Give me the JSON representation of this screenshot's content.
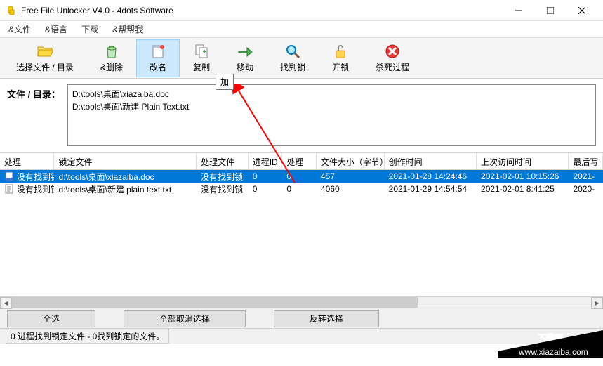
{
  "titlebar": {
    "title": "Free File Unlocker V4.0 - 4dots Software"
  },
  "menubar": {
    "file": "文件",
    "language": "语言",
    "download": "下载",
    "help": "帮帮我"
  },
  "toolbar": {
    "select": "选择文件 / 目录",
    "delete": "删除",
    "rename": "改名",
    "copy": "复制",
    "move": "移动",
    "findlock": "找到锁",
    "unlock": "开锁",
    "kill": "杀死过程"
  },
  "tooltip": "加",
  "path": {
    "label": "文件 / 目录：",
    "lines": [
      "D:\\tools\\桌面\\xiazaiba.doc",
      "D:\\tools\\桌面\\新建 Plain Text.txt"
    ]
  },
  "grid": {
    "headers": {
      "proc": "处理",
      "lockfile": "锁定文件",
      "procfile": "处理文件",
      "pid": "进程ID",
      "proc2": "处理",
      "size": "文件大小（字节）",
      "ctime": "创作时间",
      "atime": "上次访问时间",
      "mtime": "最后写"
    },
    "rows": [
      {
        "selected": true,
        "proc": "没有找到锁",
        "lockfile": "d:\\tools\\桌面\\xiazaiba.doc",
        "procfile": "没有找到锁",
        "pid": "0",
        "proc2": "0",
        "size": "457",
        "ctime": "2021-01-28 14:24:46",
        "atime": "2021-02-01 10:15:26",
        "mtime": "2021-"
      },
      {
        "selected": false,
        "proc": "没有找到锁",
        "lockfile": "d:\\tools\\桌面\\新建 plain text.txt",
        "procfile": "没有找到锁",
        "pid": "0",
        "proc2": "0",
        "size": "4060",
        "ctime": "2021-01-29 14:54:54",
        "atime": "2021-02-01 8:41:25",
        "mtime": "2020-"
      }
    ]
  },
  "buttons": {
    "selectall": "全选",
    "deselectall": "全部取消选择",
    "invert": "反转选择"
  },
  "statusbar": "0 进程找到锁定文件 - 0找到锁定的文件。",
  "watermark": {
    "main": "下载吧",
    "url": "www.xiazaiba.com"
  }
}
